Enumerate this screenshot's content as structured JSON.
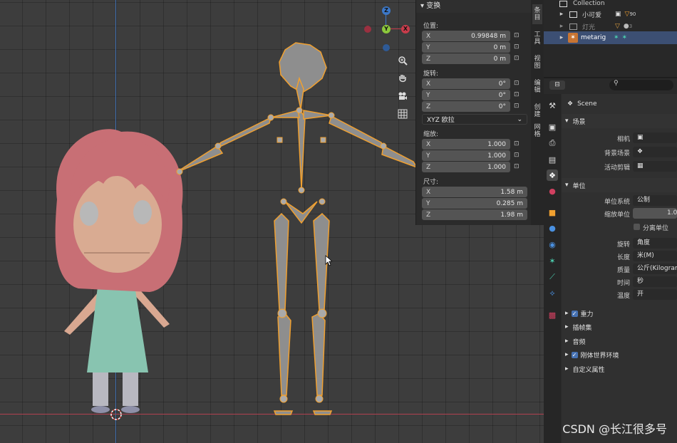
{
  "colors": {
    "accent_blue": "#4772b3",
    "selection_orange": "#f0a030",
    "axis_red": "#c83c4b",
    "axis_green": "#8cc83c",
    "axis_blue": "#3c78c8"
  },
  "viewport": {
    "gizmo": {
      "z": "Z",
      "y": "Y",
      "x": "X"
    },
    "tools": [
      "zoom-icon",
      "hand-icon",
      "camera-icon",
      "grid-icon"
    ]
  },
  "transform_panel": {
    "title": "变换",
    "location_label": "位置:",
    "location": [
      {
        "axis": "X",
        "value": "0.99848 m"
      },
      {
        "axis": "Y",
        "value": "0 m"
      },
      {
        "axis": "Z",
        "value": "0 m"
      }
    ],
    "rotation_label": "旋转:",
    "rotation": [
      {
        "axis": "X",
        "value": "0°"
      },
      {
        "axis": "Y",
        "value": "0°"
      },
      {
        "axis": "Z",
        "value": "0°"
      }
    ],
    "rotation_mode": "XYZ 欧拉",
    "scale_label": "缩放:",
    "scale": [
      {
        "axis": "X",
        "value": "1.000"
      },
      {
        "axis": "Y",
        "value": "1.000"
      },
      {
        "axis": "Z",
        "value": "1.000"
      }
    ],
    "dimensions_label": "尺寸:",
    "dimensions": [
      {
        "axis": "X",
        "value": "1.58 m"
      },
      {
        "axis": "Y",
        "value": "0.285 m"
      },
      {
        "axis": "Z",
        "value": "1.98 m"
      }
    ]
  },
  "side_tabs": [
    "条目",
    "工具",
    "视图",
    "编辑",
    "创建",
    "网格"
  ],
  "outliner": {
    "rows": [
      {
        "name": "Collection"
      },
      {
        "name": "小可爱",
        "extra": "90"
      },
      {
        "name": "灯光",
        "extra": "3"
      },
      {
        "name": "metarig"
      }
    ]
  },
  "properties": {
    "search_placeholder": "",
    "scene_name": "Scene",
    "scene_section": "场景",
    "camera_label": "相机",
    "bg_scene_label": "背景场景",
    "active_clip_label": "活动剪辑",
    "units_section": "单位",
    "unit_system_label": "单位系统",
    "unit_system_value": "公制",
    "unit_scale_label": "缩放单位",
    "unit_scale_value": "1.0",
    "separate_units_label": "分离单位",
    "rotation_label": "旋转",
    "rotation_value": "角度",
    "length_label": "长度",
    "length_value": "米(M)",
    "mass_label": "质量",
    "mass_value": "公斤(Kilogram",
    "time_label": "时间",
    "time_value": "秒",
    "temperature_label": "温度",
    "temperature_value": "开",
    "gravity_section": "重力",
    "keying_sets_section": "插帧集",
    "audio_section": "音频",
    "rigid_body_section": "刚体世界环境",
    "custom_props_section": "自定义属性"
  },
  "watermark": "CSDN @长江很多号"
}
